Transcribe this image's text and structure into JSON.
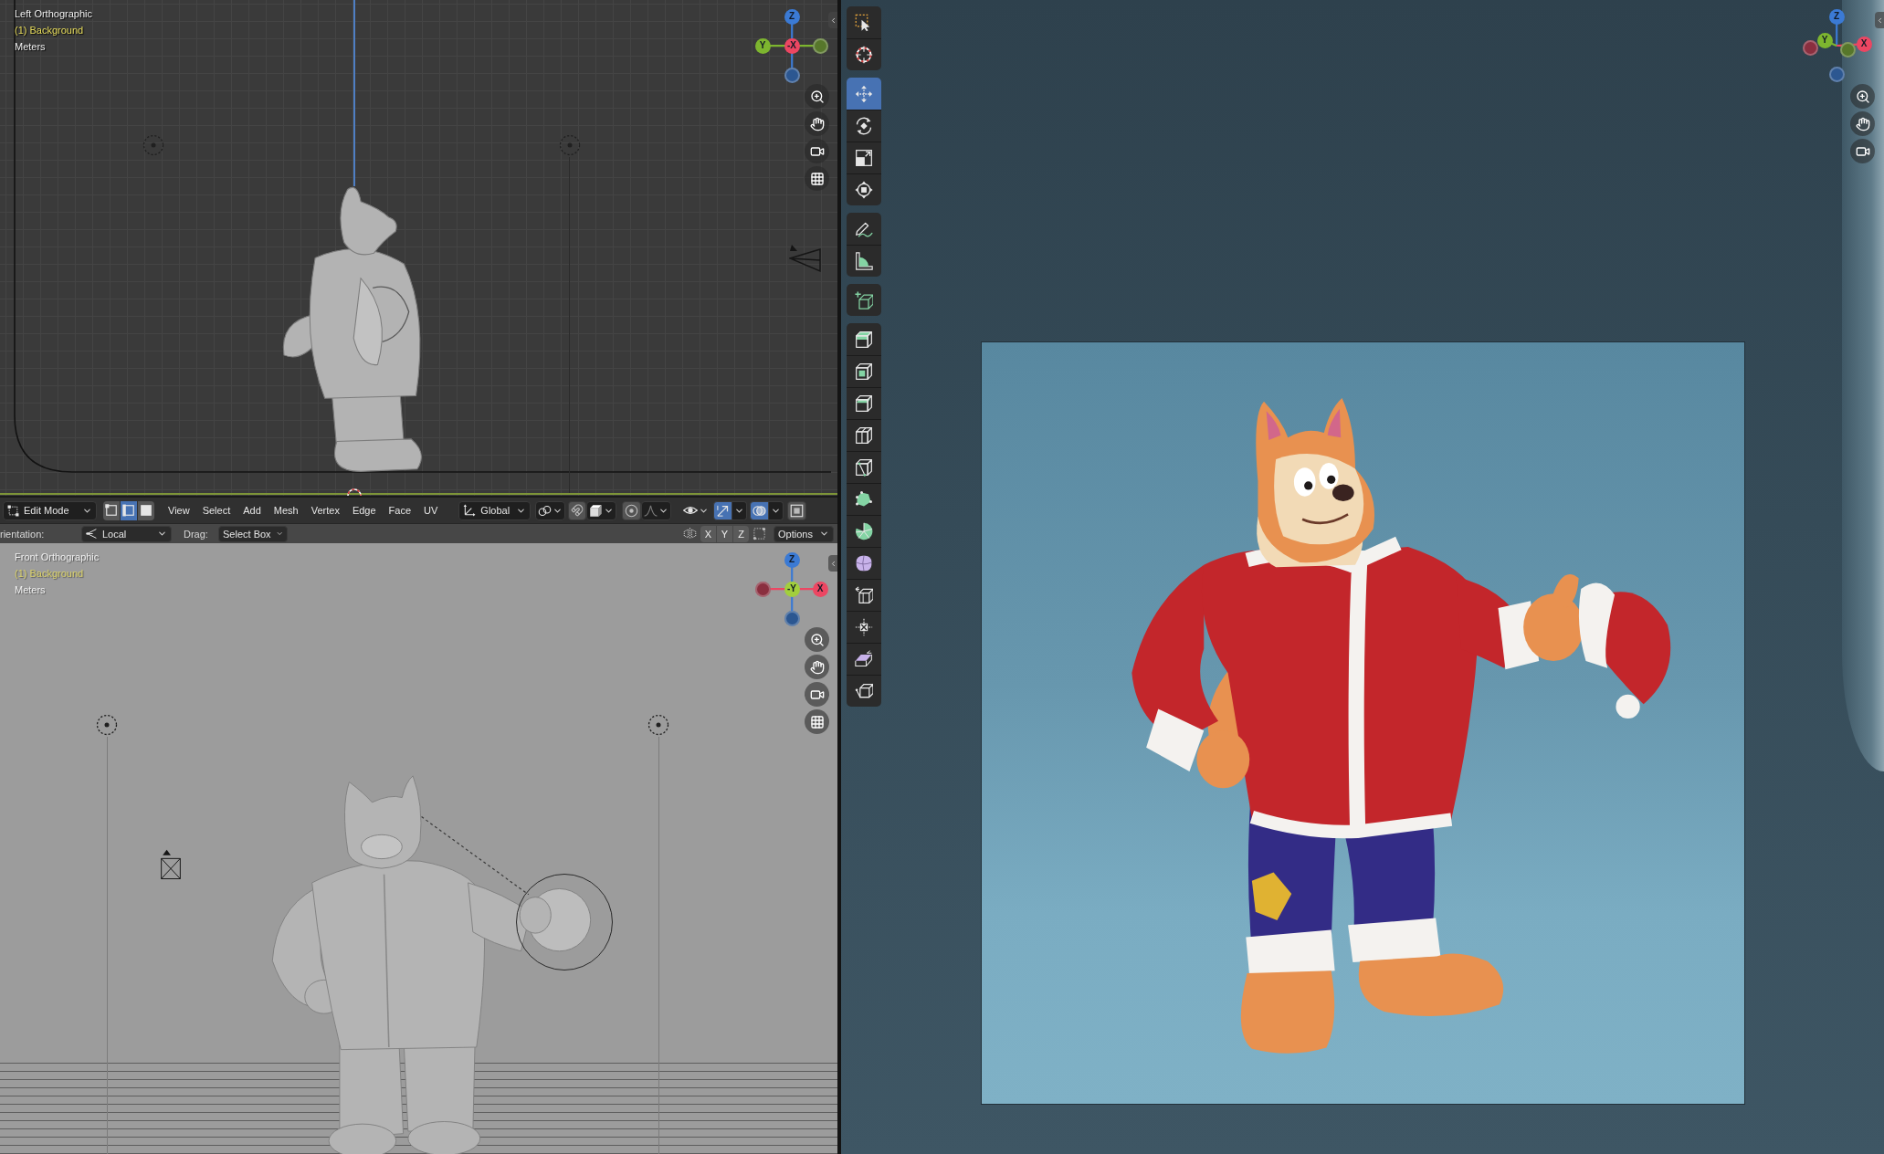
{
  "left_view": {
    "view_name": "Left Orthographic",
    "collection": "(1) Background",
    "units": "Meters",
    "gizmo": [
      {
        "label": "Z",
        "color": "#3b7ad4"
      },
      {
        "label": "Y",
        "color": "#7db52f"
      },
      {
        "label": "-X",
        "color": "#ec4662"
      },
      {
        "color": "#57772b"
      },
      {
        "color": "#2c5791"
      }
    ],
    "nav_buttons": [
      {
        "kind": "zoom"
      },
      {
        "kind": "pan"
      },
      {
        "kind": "camera"
      },
      {
        "kind": "grid"
      }
    ]
  },
  "editor_header": {
    "mode": "Edit Mode",
    "select_modes": [
      {
        "kind": "vertex",
        "selected": false
      },
      {
        "kind": "edge",
        "selected": true
      },
      {
        "kind": "face",
        "selected": false
      }
    ],
    "menus": [
      "View",
      "Select",
      "Add",
      "Mesh",
      "Vertex",
      "Edge",
      "Face",
      "UV"
    ],
    "orientation": "Global",
    "tools": [
      {
        "kind": "pivot",
        "on": false
      },
      {
        "kind": "snap",
        "on": false
      },
      {
        "kind": "snaptarget",
        "on": false
      },
      {
        "kind": "proportional",
        "on": false
      },
      {
        "kind": "falloff",
        "on": false
      },
      {
        "kind": "visibility",
        "on": false
      },
      {
        "kind": "gizmo",
        "on": true
      },
      {
        "kind": "overlay",
        "on": true
      },
      {
        "kind": "xray",
        "on": false
      }
    ]
  },
  "tool_settings": {
    "orientation_label": "rientation:",
    "orientation": "Local",
    "drag_label": "Drag:",
    "drag": "Select Box",
    "mirror": [
      {
        "label": "X",
        "on": false
      },
      {
        "label": "Y",
        "on": false
      },
      {
        "label": "Z",
        "on": false
      }
    ],
    "options": "Options"
  },
  "front_view": {
    "view_name": "Front Orthographic",
    "collection": "(1) Background",
    "units": "Meters",
    "gizmo": [
      {
        "label": "Z",
        "color": "#3b7ad4"
      },
      {
        "color": "#8a2f3f"
      },
      {
        "label": "-Y",
        "color": "#a2cf3c"
      },
      {
        "label": "X",
        "color": "#ec4662"
      },
      {
        "color": "#2c5791"
      }
    ],
    "nav_buttons": [
      {
        "kind": "zoom"
      },
      {
        "kind": "pan"
      },
      {
        "kind": "camera"
      },
      {
        "kind": "grid"
      }
    ]
  },
  "camera_view": {
    "toolbar": [
      {
        "tools": [
          {
            "kind": "select",
            "selected": false
          },
          {
            "kind": "cursor",
            "selected": false
          }
        ]
      },
      {
        "tools": [
          {
            "kind": "move",
            "selected": true
          },
          {
            "kind": "rotate",
            "selected": false
          },
          {
            "kind": "scale",
            "selected": false
          },
          {
            "kind": "transform",
            "selected": false
          }
        ]
      },
      {
        "tools": [
          {
            "kind": "annotate",
            "selected": false
          },
          {
            "kind": "measure",
            "selected": false
          }
        ]
      },
      {
        "tools": [
          {
            "kind": "cube",
            "selected": false
          }
        ]
      },
      {
        "tools": [
          {
            "kind": "extrude",
            "selected": false
          },
          {
            "kind": "inset",
            "selected": false
          },
          {
            "kind": "bevel",
            "selected": false
          },
          {
            "kind": "loopcut",
            "selected": false
          },
          {
            "kind": "knife",
            "selected": false
          },
          {
            "kind": "polybuild",
            "selected": false
          },
          {
            "kind": "spin",
            "selected": false
          },
          {
            "kind": "smooth",
            "selected": false
          },
          {
            "kind": "edgeslide",
            "selected": false
          },
          {
            "kind": "shrink",
            "selected": false
          },
          {
            "kind": "shear",
            "selected": false
          },
          {
            "kind": "rip",
            "selected": false
          }
        ]
      }
    ],
    "gizmo": [
      {
        "label": "Z",
        "color": "#3b7ad4"
      },
      {
        "label": "Y",
        "color": "#7db52f"
      },
      {
        "label": "X",
        "color": "#ec4662"
      },
      {
        "color": "#8a2f3f"
      },
      {
        "color": "#57772b"
      },
      {
        "color": "#2c5791"
      }
    ],
    "nav_buttons": [
      {
        "kind": "zoom"
      },
      {
        "kind": "pan"
      },
      {
        "kind": "camera"
      }
    ]
  }
}
